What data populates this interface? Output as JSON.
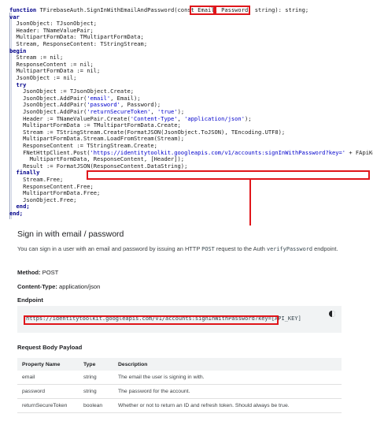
{
  "code": {
    "lines": [
      [
        {
          "t": "function ",
          "k": "kw"
        },
        {
          "t": "TFirebaseAuth.SignInWithEmailAndPassword(const "
        },
        {
          "t": "Email"
        },
        {
          "t": ", "
        },
        {
          "t": "Password"
        },
        {
          "t": ": string): string;"
        }
      ],
      [
        {
          "t": "var",
          "k": "kw"
        }
      ],
      [
        {
          "t": "  JsonObject: TJsonObject;"
        }
      ],
      [
        {
          "t": "  Header: TNameValuePair;"
        }
      ],
      [
        {
          "t": "  MultipartFormData: TMultipartFormData;"
        }
      ],
      [
        {
          "t": "  Stream, ResponseContent: TStringStream;"
        }
      ],
      [
        {
          "t": "begin",
          "k": "kw"
        }
      ],
      [
        {
          "t": "  Stream := nil;"
        }
      ],
      [
        {
          "t": "  ResponseContent := nil;"
        }
      ],
      [
        {
          "t": "  MultipartFormData := nil;"
        }
      ],
      [
        {
          "t": "  JsonObject := nil;"
        }
      ],
      [
        {
          "t": "  try",
          "k": "kw"
        }
      ],
      [
        {
          "t": "    JsonObject := TJsonObject.Create;"
        }
      ],
      [
        {
          "t": "    JsonObject.AddPair("
        },
        {
          "t": "'email'",
          "k": "str"
        },
        {
          "t": ", Email);"
        }
      ],
      [
        {
          "t": "    JsonObject.AddPair("
        },
        {
          "t": "'password'",
          "k": "str"
        },
        {
          "t": ", Password);"
        }
      ],
      [
        {
          "t": "    JsonObject.AddPair("
        },
        {
          "t": "'returnSecureToken'",
          "k": "str"
        },
        {
          "t": ", "
        },
        {
          "t": "'true'",
          "k": "str"
        },
        {
          "t": ");"
        }
      ],
      [
        {
          "t": "    Header := TNameValuePair.Create("
        },
        {
          "t": "'Content-Type'",
          "k": "str"
        },
        {
          "t": ", "
        },
        {
          "t": "'application/json'",
          "k": "str"
        },
        {
          "t": ");"
        }
      ],
      [
        {
          "t": "    MultipartFormData := TMultipartFormData.Create;"
        }
      ],
      [
        {
          "t": "    Stream := TStringStream.Create(FormatJSON(JsonObject.ToJSON), TEncoding.UTF8);"
        }
      ],
      [
        {
          "t": "    MultipartFormData.Stream.LoadFromStream(Stream);"
        }
      ],
      [
        {
          "t": "    ResponseContent := TStringStream.Create;"
        }
      ],
      [
        {
          "t": "    FNetHttpClient.Post("
        },
        {
          "t": "'https://identitytoolkit.googleapis.com/v1/accounts:signInWithPassword?key='",
          "k": "str"
        },
        {
          "t": " + FApiKey,"
        }
      ],
      [
        {
          "t": "      MultipartFormData, ResponseContent, [Header]);"
        }
      ],
      [
        {
          "t": "    Result := FormatJSON(ResponseContent.DataString);"
        }
      ],
      [
        {
          "t": "  finally",
          "k": "kw"
        }
      ],
      [
        {
          "t": "    Stream.Free;"
        }
      ],
      [
        {
          "t": "    ResponseContent.Free;"
        }
      ],
      [
        {
          "t": "    MultipartFormData.Free;"
        }
      ],
      [
        {
          "t": "    JsonObject.Free;"
        }
      ],
      [
        {
          "t": "  end;",
          "k": "kw"
        }
      ],
      [
        {
          "t": "end;",
          "k": "kw"
        }
      ]
    ]
  },
  "doc": {
    "title": "Sign in with email / password",
    "para_before_post": "You can sign in a user with an email and password by issuing an HTTP ",
    "post_code": "POST",
    "para_middle": " request to the Auth ",
    "verify_code": "verifyPassword",
    "para_end": " endpoint.",
    "method_label": "Method:",
    "method_value": " POST",
    "content_type_label": "Content-Type:",
    "content_type_value": " application/json",
    "endpoint_heading": "Endpoint",
    "endpoint_url": "https://identitytoolkit.googleapis.com/v1/accounts:signInWithPassword?key=[API_KEY]",
    "request_body_heading": "Request Body Payload",
    "table": {
      "headers": [
        "Property Name",
        "Type",
        "Description"
      ],
      "rows": [
        [
          "email",
          "string",
          "The email the user is signing in with."
        ],
        [
          "password",
          "string",
          "The password for the account."
        ],
        [
          "returnSecureToken",
          "boolean",
          "Whether or not to return an ID and refresh token. Should always be true."
        ]
      ]
    }
  },
  "colors": {
    "highlight": "#e0161b",
    "keyword": "#00008a",
    "string": "#0000cc"
  }
}
